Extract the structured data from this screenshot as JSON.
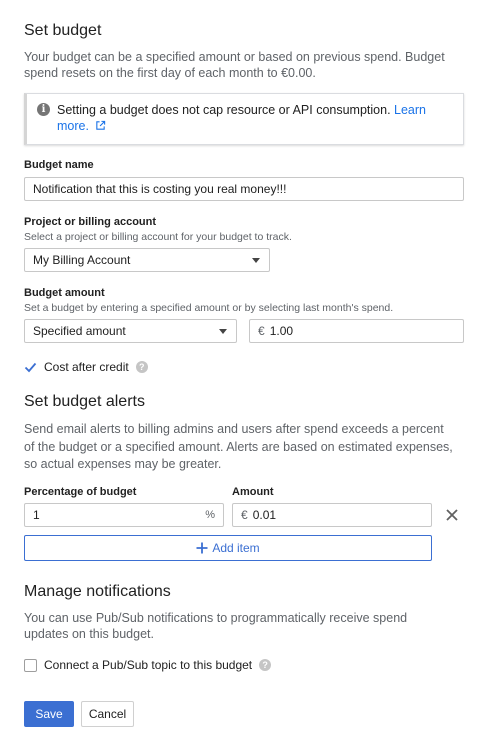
{
  "budget": {
    "title": "Set budget",
    "description": "Your budget can be a specified amount or based on previous spend. Budget spend resets on the first day of each month to €0.00.",
    "info_text": "Setting a budget does not cap resource or API consumption.",
    "info_link": "Learn more."
  },
  "budget_name": {
    "label": "Budget name",
    "value": "Notification that this is costing you real money!!!"
  },
  "project": {
    "label": "Project or billing account",
    "hint": "Select a project or billing account for your budget to track.",
    "selected": "My Billing Account"
  },
  "amount": {
    "label": "Budget amount",
    "hint": "Set a budget by entering a specified amount or by selecting last month's spend.",
    "type_selected": "Specified amount",
    "currency": "€",
    "value": "1.00"
  },
  "cost_after_credit": {
    "label": "Cost after credit",
    "checked": true
  },
  "alerts": {
    "title": "Set budget alerts",
    "description": "Send email alerts to billing admins and users after spend exceeds a percent of the budget or a specified amount. Alerts are based on estimated expenses, so actual expenses may be greater.",
    "percentage_header": "Percentage of budget",
    "amount_header": "Amount",
    "rows": [
      {
        "percentage": "1",
        "percent_sign": "%",
        "currency": "€",
        "amount": "0.01"
      }
    ],
    "add_item_label": "Add item"
  },
  "notifications": {
    "title": "Manage notifications",
    "description": "You can use Pub/Sub notifications to programmatically receive spend updates on this budget.",
    "pubsub_label": "Connect a Pub/Sub topic to this budget",
    "pubsub_checked": false
  },
  "actions": {
    "save_label": "Save",
    "cancel_label": "Cancel"
  },
  "colors": {
    "accent": "#3b6fd2",
    "link": "#1a73e8",
    "text_secondary": "#5f6368"
  }
}
